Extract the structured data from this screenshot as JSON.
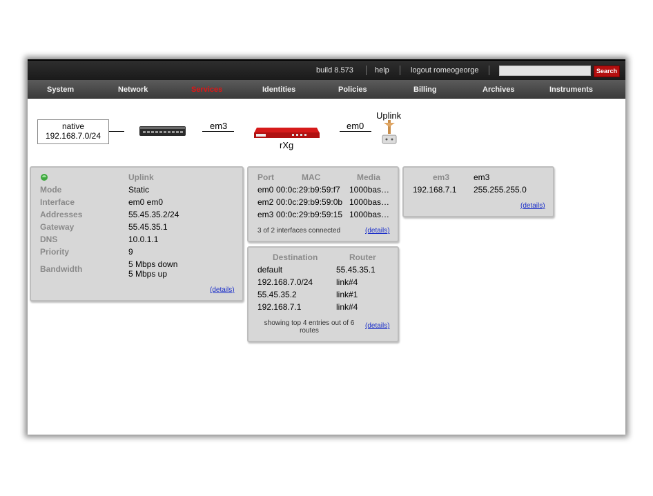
{
  "topbar": {
    "build": "build 8.573",
    "help": "help",
    "logout": "logout romeogeorge",
    "search_value": "",
    "search_button": "Search"
  },
  "nav": [
    "System",
    "Network",
    "Services",
    "Identities",
    "Policies",
    "Billing",
    "Archives",
    "Instruments"
  ],
  "nav_active": "Services",
  "colors": {
    "accent": "#b40f0f",
    "active_nav": "#e41414",
    "panel_bg": "#d7d7d7",
    "link": "#1a2ec9"
  },
  "diagram": {
    "native_name": "native",
    "native_ip": "192.168.7.0/24",
    "em3_label": "em3",
    "rxg_label": "rXg",
    "em0_label": "em0",
    "uplink_label": "Uplink"
  },
  "uplink_panel": {
    "status_icon": "green-status-icon",
    "title": "Uplink",
    "rows": [
      {
        "key": "Mode",
        "value": "Static"
      },
      {
        "key": "Interface",
        "value": "em0 em0"
      },
      {
        "key": "Addresses",
        "value": "55.45.35.2/24"
      },
      {
        "key": "Gateway",
        "value": "55.45.35.1"
      },
      {
        "key": "DNS",
        "value": "10.0.1.1"
      },
      {
        "key": "Priority",
        "value": "9"
      }
    ],
    "bandwidth_key": "Bandwidth",
    "bandwidth_down": "5 Mbps down",
    "bandwidth_up": "5 Mbps up",
    "details": "(details)"
  },
  "ports_panel": {
    "headers": [
      "Port",
      "MAC",
      "Media"
    ],
    "rows": [
      {
        "port": "em0",
        "mac": "00:0c:29:b9:59:f7",
        "media": "1000bas…"
      },
      {
        "port": "em2",
        "mac": "00:0c:29:b9:59:0b",
        "media": "1000bas…"
      },
      {
        "port": "em3",
        "mac": "00:0c:29:b9:59:15",
        "media": "1000bas…"
      }
    ],
    "footer": "3 of 2 interfaces connected",
    "details": "(details)"
  },
  "routes_panel": {
    "headers": [
      "Destination",
      "Router"
    ],
    "rows": [
      {
        "destination": "default",
        "router": "55.45.35.1"
      },
      {
        "destination": "192.168.7.0/24",
        "router": "link#4"
      },
      {
        "destination": "55.45.35.2",
        "router": "link#1"
      },
      {
        "destination": "192.168.7.1",
        "router": "link#4"
      }
    ],
    "footer_line1": "showing top 4 entries out of 6",
    "footer_line2": "routes",
    "details": "(details)"
  },
  "em3_panel": {
    "headers": [
      "em3",
      "em3"
    ],
    "ip": "192.168.7.1",
    "mask": "255.255.255.0",
    "details": "(details)"
  }
}
